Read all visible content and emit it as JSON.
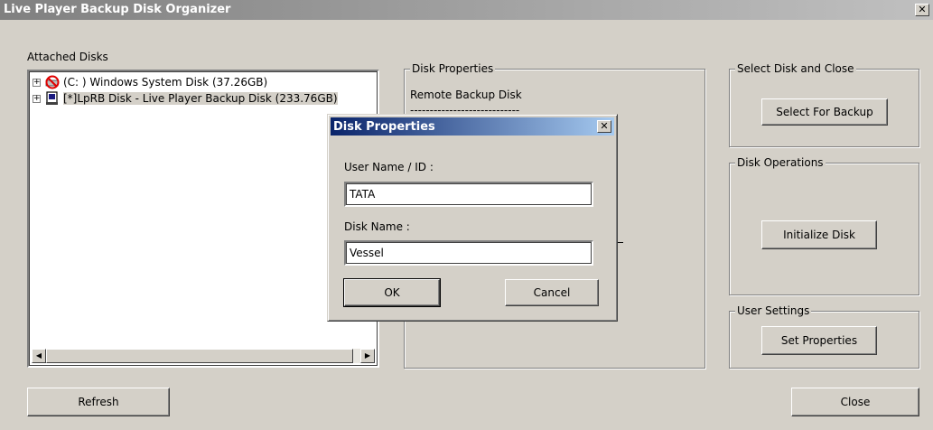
{
  "window": {
    "title": "Live Player Backup Disk Organizer",
    "close_glyph": "✕"
  },
  "attached_disks": {
    "label": "Attached Disks",
    "items": [
      {
        "label": "(C: ) Windows System Disk (37.26GB)",
        "icon": "no-entry-disk-icon",
        "expander": "+"
      },
      {
        "label": "[*]LpRB Disk - Live Player Backup Disk  (233.76GB)",
        "icon": "backup-disk-icon",
        "expander": "+"
      }
    ]
  },
  "disk_properties_panel": {
    "title": "Disk Properties",
    "line1": "Remote Backup Disk",
    "line2": "----------------------------"
  },
  "select_group": {
    "title": "Select Disk and Close",
    "button": "Select For Backup"
  },
  "disk_ops_group": {
    "title": "Disk Operations",
    "button": "Initialize Disk"
  },
  "user_settings_group": {
    "title": "User Settings",
    "button": "Set Properties"
  },
  "buttons": {
    "refresh": "Refresh",
    "close": "Close"
  },
  "dialog": {
    "title": "Disk Properties",
    "close_glyph": "✕",
    "user_label": "User Name / ID :",
    "user_value": "TATA",
    "disk_label": "Disk Name :",
    "disk_value": "Vessel",
    "ok": "OK",
    "cancel": "Cancel"
  },
  "colors": {
    "face": "#d4d0c8",
    "inactive_title": "#808080",
    "active_title": "#0a246a"
  }
}
